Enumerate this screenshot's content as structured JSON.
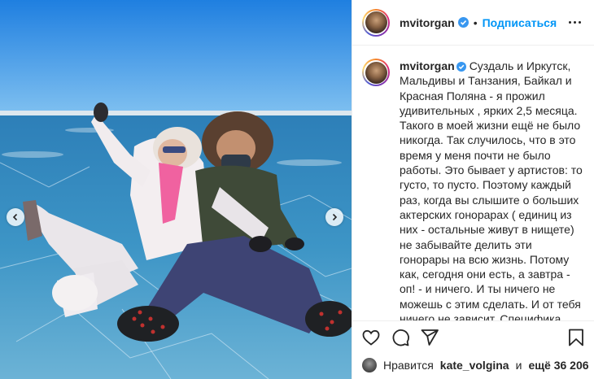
{
  "post": {
    "username": "mvitorgan",
    "follow_label": "Подписаться",
    "dot": "•",
    "caption": "Суздаль и Иркутск, Мальдивы и Танзания, Байкал и Красная Поляна - я прожил удивительных , ярких 2,5 месяца. Такого в моей жизни ещё не было никогда. Так случилось, что в это время у меня почти не было работы. Это бывает у артистов: то густо, то пусто. Поэтому каждый раз, когда вы слышите о больших актерских гонорарах ( единиц из них - остальные живут в нищете) не забывайте делить эти гонорары на всю жизнь. Потому как, сегодня они есть, а завтра - оп! - и ничего. И ты ничего не можешь с этим сделать. И от тебя ничего не зависит. Специфика профессии такая. Но это так - к слову.",
    "likes_prefix": "Нравится",
    "likes_user": "kate_volgina",
    "likes_conj": "и",
    "likes_others": "ещё 36 206"
  },
  "icons": {
    "verified": "verified-badge-icon",
    "more": "more-options-icon",
    "like": "heart-icon",
    "comment": "comment-icon",
    "share": "share-icon",
    "save": "bookmark-icon",
    "prev": "chevron-left-icon",
    "next": "chevron-right-icon"
  },
  "colors": {
    "accent": "#0095f6",
    "text": "#262626",
    "sky": "#2f8fe6",
    "ice": "#3a8fc0"
  }
}
